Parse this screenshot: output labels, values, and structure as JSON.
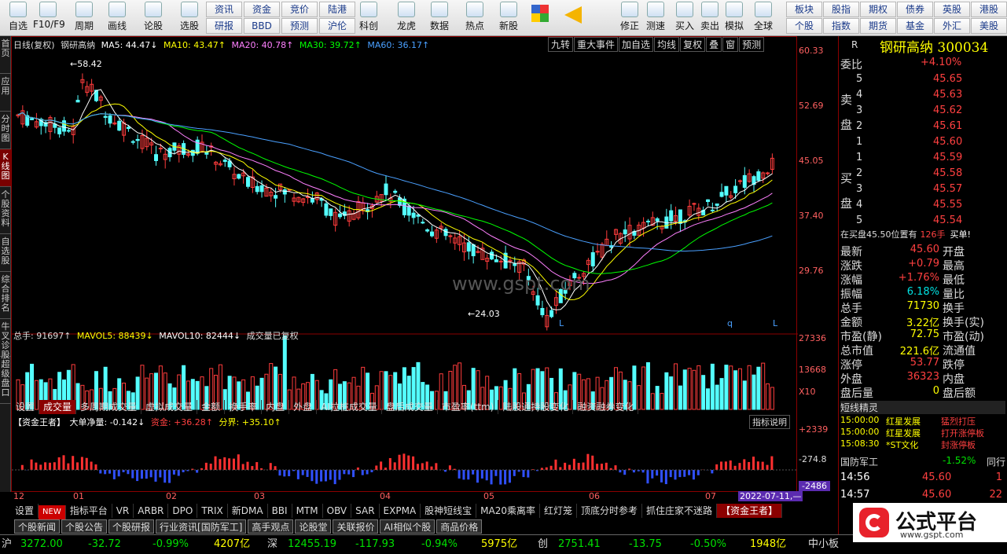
{
  "toolbar": {
    "items": [
      {
        "label": "自选",
        "icon": "star-list-icon"
      },
      {
        "label": "F10/F9",
        "icon": "f10-icon"
      },
      {
        "label": "周期",
        "icon": "clock-icon"
      },
      {
        "label": "画线",
        "icon": "pen-icon"
      },
      {
        "label": "论股",
        "icon": "discuss-icon"
      },
      {
        "label": "选股",
        "icon": "select-stock-icon"
      },
      {
        "label": "科创",
        "icon": "chart-icon"
      },
      {
        "label": "龙虎",
        "icon": "dragon-tiger-icon"
      },
      {
        "label": "数据",
        "icon": "pe-icon"
      },
      {
        "label": "热点",
        "icon": "hot-icon"
      },
      {
        "label": "新股",
        "icon": "new-stock-icon"
      },
      {
        "label": "修正",
        "icon": "up-arrow-icon"
      },
      {
        "label": "测速",
        "icon": "speed-icon"
      },
      {
        "label": "买入",
        "icon": "buy-icon"
      },
      {
        "label": "卖出",
        "icon": "sell-icon"
      },
      {
        "label": "模拟",
        "icon": "hammer-icon"
      },
      {
        "label": "全球",
        "icon": "globe-icon"
      }
    ],
    "grid1": [
      [
        "资讯",
        "研报"
      ],
      [
        "资金",
        "BBD"
      ],
      [
        "竞价",
        "预测"
      ],
      [
        "陆港",
        "沪伦"
      ]
    ],
    "grid2": [
      [
        "板块",
        "个股"
      ],
      [
        "股指",
        "指数"
      ],
      [
        "期权",
        "期货"
      ],
      [
        "债券",
        "基金"
      ],
      [
        "英股",
        "外汇"
      ],
      [
        "港股",
        "美股"
      ]
    ],
    "buy_glyph": "买",
    "sell_glyph": "卖",
    "sell_char": "买"
  },
  "lefttabs": [
    "首页",
    "应用",
    "分时图",
    "K线图",
    "个股资料",
    "自选股",
    "综合排名",
    "牛叉诊股",
    "超级盘口"
  ],
  "chart": {
    "header": {
      "kind": "日线(复权)",
      "name": "钢研高纳",
      "ma5": "MA5: 44.47↓",
      "ma10": "MA10: 43.47↑",
      "ma20": "MA20: 40.78↑",
      "ma30": "MA30: 39.72↑",
      "ma60": "MA60: 36.17↑"
    },
    "topbtns": [
      "九转",
      "重大事件",
      "加自选",
      "均线",
      "复权",
      "叠",
      "窗",
      "预测"
    ],
    "yaxis": [
      "60.33",
      "52.69",
      "45.05",
      "37.40",
      "29.76"
    ],
    "hi_label": "58.42",
    "lo_label": "24.03",
    "watermark": "www.gspt.com",
    "marks": [
      "L",
      "q",
      "L"
    ],
    "vol": {
      "total": "总手: 91697↑",
      "mavol5": "MAVOL5: 88439↓",
      "mavol10": "MAVOL10: 82444↓",
      "note": "成交量已复权",
      "axis": [
        "27336",
        "13668",
        "X10"
      ]
    },
    "vtabs": [
      "设置",
      "成交量",
      "多周期成交量",
      "虚拟成交量",
      "金额",
      "换手率",
      "内盘",
      "外盘",
      "AI拉桩成交量",
      "盘后成交量",
      "市盈率(ttm)",
      "陆股通持股变化",
      "融资融券变化"
    ],
    "fund": {
      "title": "【资金王者】",
      "net": "大单净量: -0.142↓",
      "fund": "资金: +36.28↑",
      "div": "分界: +35.10↑",
      "explain": "指标说明",
      "axis": [
        "+2339",
        "-274.8",
        "-2486"
      ]
    },
    "months": [
      "12",
      "01",
      "02",
      "03",
      "04",
      "05",
      "06",
      "07"
    ],
    "date_tag": "2022-07-11,—",
    "itabs": [
      "设置",
      "NEW",
      "指标平台",
      "VR",
      "ARBR",
      "DPO",
      "TRIX",
      "新DMA",
      "BBI",
      "MTM",
      "OBV",
      "SAR",
      "EXPMA",
      "股神短线宝",
      "MA20乘离率",
      "红灯笼",
      "顶底分时参考",
      "抓住庄家不迷路",
      "【资金王者】"
    ]
  },
  "quote": {
    "code": "R",
    "title": "钢研高纳 300034",
    "weibi_label": "委比",
    "weibi": "+4.10%",
    "sell_label": [
      "卖",
      "盘"
    ],
    "buy_label": [
      "买",
      "盘"
    ],
    "asks": [
      {
        "n": "5",
        "p": "45.65"
      },
      {
        "n": "4",
        "p": "45.63"
      },
      {
        "n": "3",
        "p": "45.62"
      },
      {
        "n": "2",
        "p": "45.61"
      },
      {
        "n": "1",
        "p": "45.60"
      }
    ],
    "bids": [
      {
        "n": "1",
        "p": "45.59"
      },
      {
        "n": "2",
        "p": "45.58"
      },
      {
        "n": "3",
        "p": "45.57"
      },
      {
        "n": "4",
        "p": "45.55"
      },
      {
        "n": "5",
        "p": "45.54"
      }
    ],
    "notice": "在买盘45.50位置有",
    "notice_qty": "126手",
    "notice_act": "买单!",
    "stats": [
      [
        "最新",
        "45.60",
        "开盘",
        ""
      ],
      [
        "涨跌",
        "+0.79",
        "最高",
        ""
      ],
      [
        "涨幅",
        "+1.76%",
        "最低",
        ""
      ],
      [
        "振幅",
        "6.18%",
        "量比",
        ""
      ],
      [
        "总手",
        "71730",
        "换手",
        ""
      ],
      [
        "金额",
        "3.22亿",
        "换手(实)",
        ""
      ],
      [
        "市盈(静)",
        "72.75",
        "市盈(动)",
        ""
      ],
      [
        "总市值",
        "221.6亿",
        "流通值",
        ""
      ],
      [
        "涨停",
        "53.77",
        "跌停",
        ""
      ],
      [
        "外盘",
        "36323",
        "内盘",
        ""
      ],
      [
        "盘后量",
        "0",
        "盘后额",
        ""
      ]
    ],
    "short_title": "短线精灵",
    "short": [
      [
        "15:00:00",
        "红星发展",
        "猛烈打压"
      ],
      [
        "15:00:00",
        "红星发展",
        "打开涨停板"
      ],
      [
        "15:08:30",
        "*ST文化",
        "封涨停板"
      ]
    ],
    "sector": "国防军工",
    "sector_chg": "-1.52%",
    "sector_more": "同行",
    "ticks": [
      [
        "14:56",
        "45.60",
        "1"
      ],
      [
        "14:57",
        "45.60",
        "22"
      ]
    ]
  },
  "news_tabs": [
    "个股新闻",
    "个股公告",
    "个股研报",
    "行业资讯[国防军工]",
    "高手观点",
    "论股堂",
    "关联报价",
    "AI相似个股",
    "商品价格"
  ],
  "status": {
    "sh_label": "沪",
    "sh": "3272.00",
    "sh_chg": "-32.72",
    "sh_pct": "-0.99%",
    "sh_amt": "4207亿",
    "sz_label": "深",
    "sz": "12455.19",
    "sz_chg": "-117.93",
    "sz_pct": "-0.94%",
    "sz_amt": "5975亿",
    "cy_label": "创",
    "cy": "2751.41",
    "cy_chg": "-13.75",
    "cy_pct": "-0.50%",
    "cy_amt": "1948亿",
    "right": "中小板"
  },
  "logo": {
    "text": "公式平台",
    "url": "www.gspt.com"
  },
  "colors": {
    "up": "#ff3c3c",
    "down": "#54ffff",
    "ma5": "#ffffff",
    "ma10": "#ffff00",
    "ma20": "#ff80ff",
    "ma30": "#00ff00",
    "ma60": "#4aa0ff"
  }
}
